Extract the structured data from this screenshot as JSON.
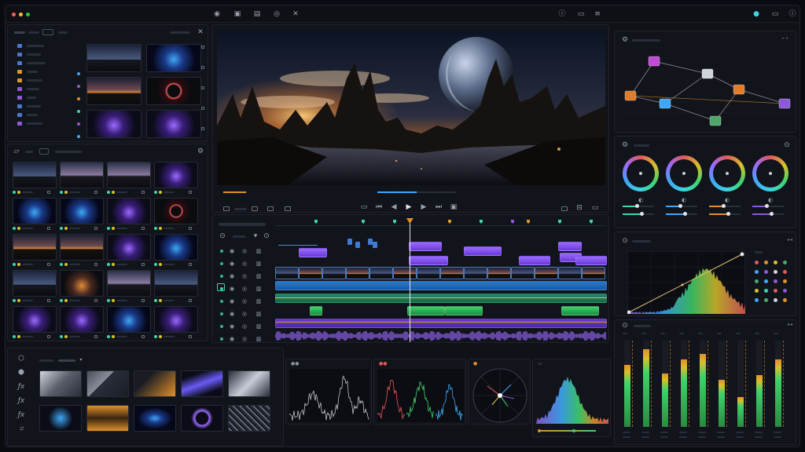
{
  "window": {
    "traffic_lights": [
      "#ff5f57",
      "#febc2e",
      "#28c840"
    ]
  },
  "toolbar": {
    "center_icons": [
      "media-icon",
      "cut-icon",
      "edit-icon",
      "fusion-icon",
      "color-icon"
    ],
    "right_icons": [
      "info-icon",
      "export-icon",
      "menu-icon"
    ],
    "far_right_icons": [
      "record-icon",
      "deliver-icon",
      "help-icon"
    ]
  },
  "media_pool": {
    "folder_colors": [
      "#4a78c9",
      "#4a78c9",
      "#4a78c9",
      "#d79a2b",
      "#d79a2b",
      "#8c5ad6",
      "#8c5ad6",
      "#4a78c9",
      "#4a78c9",
      "#8c5ad6"
    ],
    "bin_dot_colors": [
      "#3fa7f5",
      "#8c5ad6",
      "#e0902a",
      "#3fd3b0",
      "#8c5ad6",
      "#3fa7f5"
    ]
  },
  "viewer": {
    "playback_icons": [
      "stop-icon",
      "skip-back-icon",
      "step-back-icon",
      "play-icon",
      "step-forward-icon",
      "skip-forward-icon",
      "loop-icon"
    ],
    "progress": 0.12,
    "scrub_position": 0.5
  },
  "timeline": {
    "playhead_fraction": 0.405,
    "markers": [
      "#3fd3b0",
      "#3fd3b0",
      "#3fd3b0",
      "#d79a2b",
      "#3fd3b0",
      "#8c5ad6",
      "#d79a2b",
      "#3fd3b0",
      "#3fd3b0"
    ],
    "track_icons": [
      "eye-icon",
      "lock-icon",
      "mute-icon"
    ]
  },
  "color_wheels": {
    "wheels": 4,
    "slider_colors": [
      "#3fd3b0",
      "#3fa7f5",
      "#e0902a",
      "#8c5ad6"
    ]
  },
  "node_graph": {
    "node_colors": [
      "#e07b2a",
      "#c04ad6",
      "#3fa7f5",
      "#d0d4dc",
      "#e07b2a",
      "#8c5ad6",
      "#4fa66a"
    ]
  },
  "meters": {
    "levels": [
      0.72,
      0.9,
      0.62,
      0.78,
      0.85,
      0.55,
      0.35,
      0.6,
      0.78
    ]
  },
  "effects": {
    "side_icons": [
      "box-icon",
      "cube-icon",
      "fx-icon",
      "fx-icon",
      "fx-icon",
      "transform-icon"
    ],
    "fx_label": "fx"
  },
  "palette_dots": [
    "#e05a5a",
    "#e0902a",
    "#d7c02b",
    "#4fa66a",
    "#3fa7f5",
    "#8c5ad6",
    "#d0d4dc",
    "#e05a5a",
    "#4fa66a",
    "#3fa7f5",
    "#8c5ad6",
    "#e0902a",
    "#d7c02b",
    "#3fd3b0",
    "#e05a5a",
    "#8c5ad6",
    "#3fa7f5",
    "#4fa66a",
    "#d0d4dc",
    "#e0902a"
  ]
}
